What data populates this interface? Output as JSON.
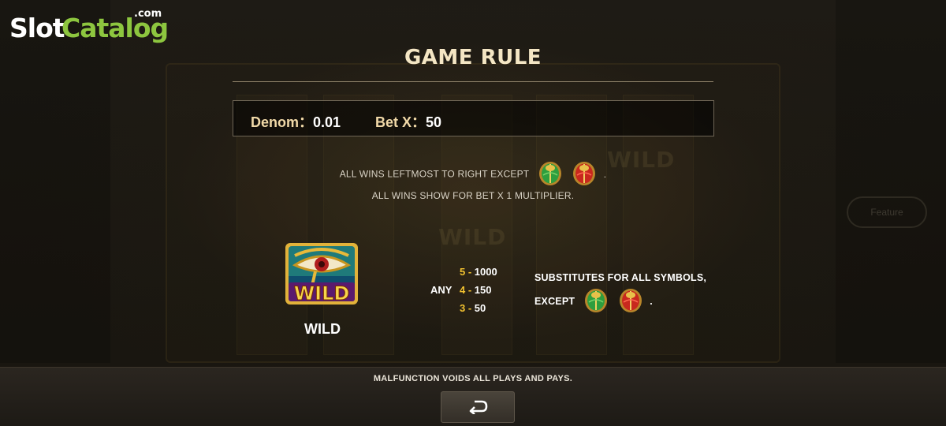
{
  "logo": {
    "slot": "Slot",
    "catalog": "Catalog",
    "com": ".com"
  },
  "background": {
    "feature_label": "Feature",
    "wild_watermark": "WILD"
  },
  "title": "GAME RULE",
  "denom": {
    "denom_label": "Denom：",
    "denom_value": "0.01",
    "bet_label": "Bet X：",
    "bet_value": "50"
  },
  "rules": {
    "line1": "ALL WINS LEFTMOST TO RIGHT EXCEPT",
    "line1_end": ".",
    "line2": "ALL WINS SHOW FOR BET X 1 MULTIPLIER."
  },
  "wild": {
    "symbol_text": "WILD",
    "name": "WILD",
    "any_label": "ANY",
    "pays": [
      {
        "count": "5 -",
        "value": "1000"
      },
      {
        "count": "4 -",
        "value": "150"
      },
      {
        "count": "3 -",
        "value": "50"
      }
    ],
    "substitute_line1": "SUBSTITUTES FOR ALL SYMBOLS,",
    "substitute_line2": "EXCEPT",
    "substitute_end": "."
  },
  "footer": {
    "notice": "MALFUNCTION VOIDS ALL PLAYS AND PAYS."
  },
  "colors": {
    "title": "#f4e6c4",
    "pay_count": "#f2c230",
    "logo_green": "#8dc63f",
    "scarab_green": "#2e9e3e",
    "scarab_red": "#c8281e"
  },
  "icons": {
    "green_scarab": "green-scarab-icon",
    "red_scarab": "red-scarab-icon",
    "back": "return-arrow-icon"
  }
}
